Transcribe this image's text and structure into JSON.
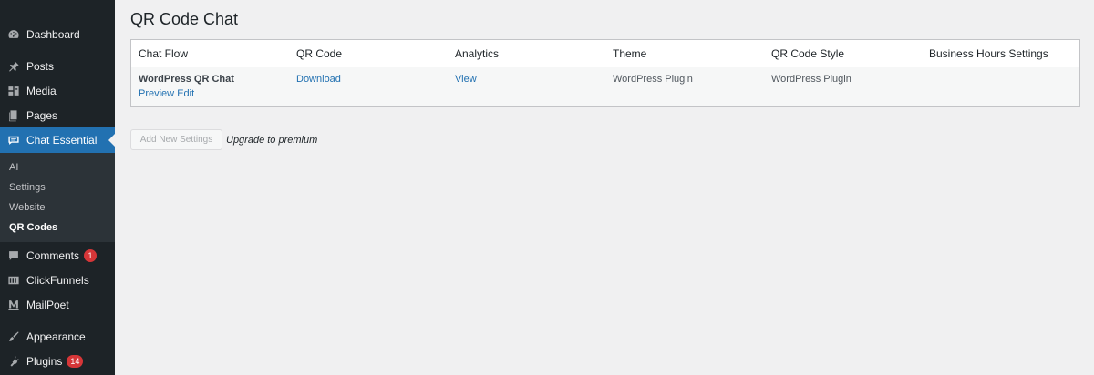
{
  "sidebar": {
    "items": [
      {
        "label": "Dashboard",
        "icon": "dashboard-icon"
      },
      {
        "label": "Posts",
        "icon": "pin-icon"
      },
      {
        "label": "Media",
        "icon": "media-icon"
      },
      {
        "label": "Pages",
        "icon": "pages-icon"
      },
      {
        "label": "Chat Essential",
        "icon": "chat-icon",
        "active": true
      },
      {
        "label": "Comments",
        "icon": "comment-icon",
        "badge": "1"
      },
      {
        "label": "ClickFunnels",
        "icon": "clickfunnels-icon"
      },
      {
        "label": "MailPoet",
        "icon": "mailpoet-icon"
      },
      {
        "label": "Appearance",
        "icon": "brush-icon"
      },
      {
        "label": "Plugins",
        "icon": "plugin-icon",
        "badge": "14"
      }
    ],
    "submenu": [
      "AI",
      "Settings",
      "Website",
      "QR Codes"
    ],
    "submenu_current": "QR Codes"
  },
  "page": {
    "title": "QR Code Chat"
  },
  "table": {
    "headers": [
      "Chat Flow",
      "QR Code",
      "Analytics",
      "Theme",
      "QR Code Style",
      "Business Hours Settings"
    ],
    "rows": [
      {
        "chat_flow": "WordPress QR Chat",
        "actions": [
          "Preview",
          "Edit"
        ],
        "qr_code": "Download",
        "analytics": "View",
        "theme": "WordPress Plugin",
        "qr_code_style": "WordPress Plugin",
        "business_hours": ""
      }
    ]
  },
  "footer": {
    "add_new_label": "Add New Settings",
    "upgrade_text": "Upgrade to premium"
  },
  "colors": {
    "sidebar_bg": "#1d2327",
    "accent": "#2271b1",
    "badge": "#d63638",
    "page_bg": "#f0f0f1"
  }
}
